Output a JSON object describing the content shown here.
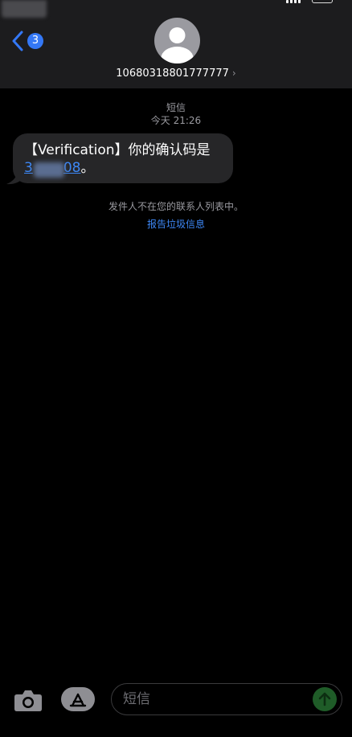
{
  "header": {
    "back_badge_count": "3",
    "contact_number": "10680318801777777",
    "contact_chevron": "›"
  },
  "thread": {
    "service_label": "短信",
    "timestamp": "今天 21:26",
    "message": {
      "text_prefix": "【Verification】你的确认码是",
      "code_start": "3",
      "code_end": "08",
      "text_suffix": "。"
    },
    "unknown_sender_notice": "发件人不在您的联系人列表中。",
    "report_junk_link": "报告垃圾信息"
  },
  "composer": {
    "placeholder": "短信"
  },
  "colors": {
    "accent": "#3478f6",
    "bubble": "#262628",
    "header": "#1c1c1e"
  },
  "icons": [
    "back-chevron-icon",
    "contact-avatar-icon",
    "camera-icon",
    "app-store-icon",
    "send-arrow-icon"
  ]
}
